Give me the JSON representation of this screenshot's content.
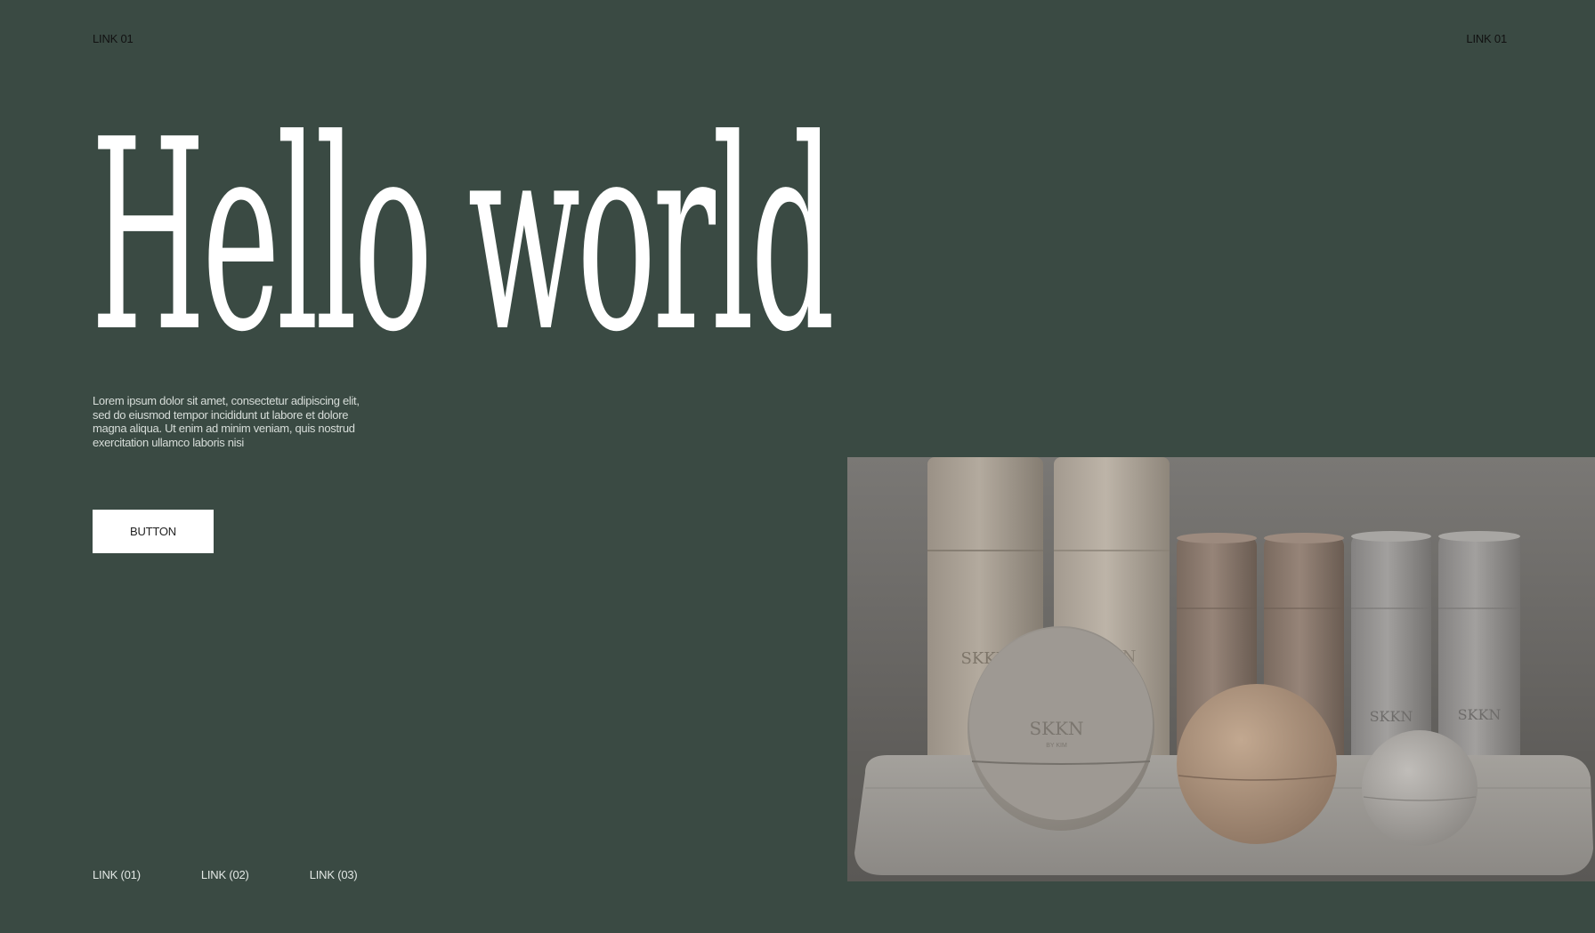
{
  "header": {
    "left_link": "LINK 01",
    "right_link": "LINK 01"
  },
  "hero": {
    "title": "Hello world",
    "body": "Lorem ipsum dolor sit amet, consectetur adipiscing elit, sed do eiusmod tempor incididunt ut labore et dolore magna aliqua. Ut enim ad minim veniam, quis nostrud exercitation ullamco laboris nisi",
    "button_label": "BUTTON"
  },
  "footer": {
    "links": [
      "LINK (01)",
      "LINK (02)",
      "LINK (03)"
    ]
  },
  "product_image": {
    "brand_text": "SKKN",
    "brand_sub": "BY KIM"
  },
  "colors": {
    "background": "#3a4a43",
    "title": "#ffffff",
    "button_bg": "#ffffff"
  }
}
